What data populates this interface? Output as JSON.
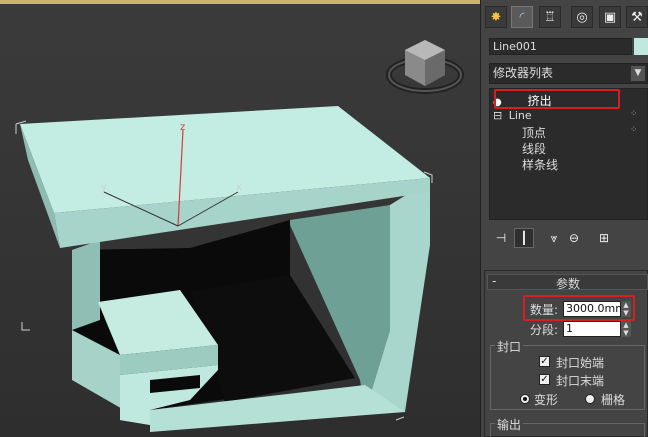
{
  "viewport": {
    "axis_z": "z",
    "axis_x": "x",
    "axis_y": "y"
  },
  "tabs": [
    {
      "icon": "sun-create-icon"
    },
    {
      "icon": "modify-arc-icon"
    },
    {
      "icon": "hierarchy-icon"
    },
    {
      "icon": "motion-icon"
    },
    {
      "icon": "display-monitor-icon"
    },
    {
      "icon": "utilities-hammer-icon"
    }
  ],
  "object_name": "Line001",
  "object_color": "#bfe9df",
  "modifier_list": {
    "label": "修改器列表"
  },
  "stack": {
    "extrude": "挤出",
    "line": "Line",
    "sub": [
      "顶点",
      "线段",
      "样条线"
    ]
  },
  "params": {
    "title": "参数",
    "amount_label": "数量:",
    "amount_value": "3000.0mm",
    "segments_label": "分段:",
    "segments_value": "1",
    "cap_group": "封口",
    "cap_start": "封口始端",
    "cap_end": "封口末端",
    "morph": "变形",
    "grid": "栅格",
    "output_group": "输出"
  },
  "colors": {
    "highlight": "#d62020",
    "model": "#bfe9df"
  }
}
